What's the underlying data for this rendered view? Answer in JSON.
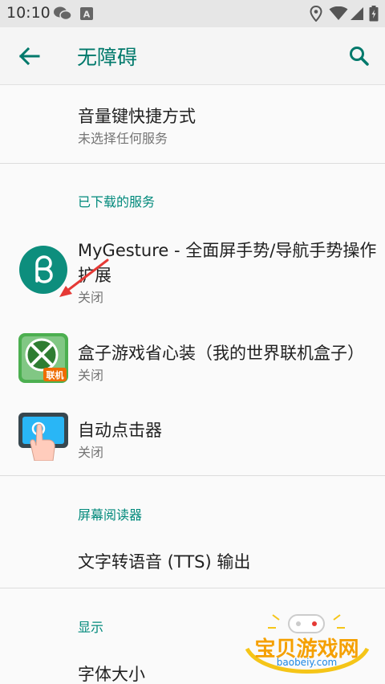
{
  "status_bar": {
    "time": "10:10"
  },
  "toolbar": {
    "title": "无障碍"
  },
  "volume_shortcut": {
    "title": "音量键快捷方式",
    "subtitle": "未选择任何服务"
  },
  "downloaded_section": {
    "header": "已下载的服务",
    "items": [
      {
        "title_line1": "MyGesture - 全面屏手势/导航手势操作",
        "title_line2": "扩展",
        "status": "关闭"
      },
      {
        "title": "盒子游戏省心装（我的世界联机盒子）",
        "status": "关闭",
        "badge": "联机"
      },
      {
        "title": "自动点击器",
        "status": "关闭"
      }
    ]
  },
  "screen_reader_section": {
    "header": "屏幕阅读器",
    "items": [
      {
        "title": "文字转语音 (TTS) 输出"
      }
    ]
  },
  "display_section": {
    "header": "显示",
    "items": [
      {
        "title": "字体大小"
      }
    ]
  },
  "watermark": {
    "brand": "宝贝游戏网",
    "url": "baobeiy.com"
  },
  "colors": {
    "accent": "#00796b",
    "section_header": "#00897b"
  }
}
